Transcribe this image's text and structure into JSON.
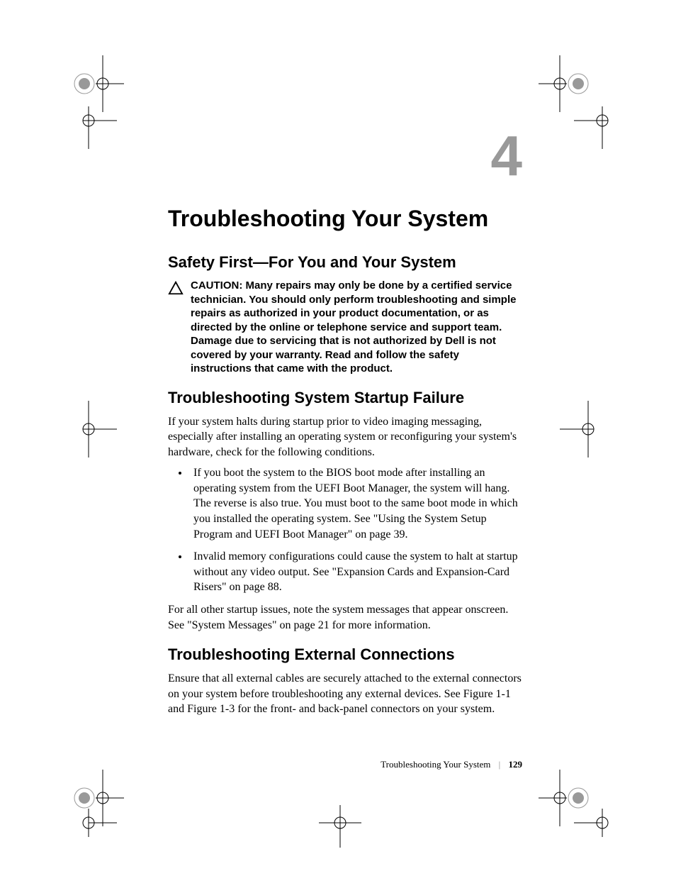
{
  "chapter_number": "4",
  "title": "Troubleshooting Your System",
  "sections": {
    "safety": {
      "heading": "Safety First—For You and Your System",
      "caution_label": "CAUTION: ",
      "caution_body": "Many repairs may only be done by a certified service technician. You should only perform troubleshooting and simple repairs as authorized in your product documentation, or as directed by the online or telephone service and support team. Damage due to servicing that is not authorized by Dell is not covered by your warranty. Read and follow the safety instructions that came with the product."
    },
    "startup": {
      "heading": "Troubleshooting System Startup Failure",
      "intro": "If your system halts during startup prior to video imaging messaging, especially after installing an operating system or reconfiguring your system's hardware, check for the following conditions.",
      "bullets": [
        "If you boot the system to the BIOS boot mode after installing an operating system from the UEFI Boot Manager, the system will hang. The reverse is also true. You must boot to the same boot mode in which you installed the operating system. See \"Using the System Setup Program and UEFI Boot Manager\" on page 39.",
        "Invalid memory configurations could cause the system to halt at startup without any video output. See \"Expansion Cards and Expansion-Card Risers\" on page 88."
      ],
      "outro": "For all other startup issues, note the system messages that appear onscreen. See \"System Messages\" on page 21 for more information."
    },
    "external": {
      "heading": "Troubleshooting External Connections",
      "body": "Ensure that all external cables are securely attached to the external connectors on your system before troubleshooting any external devices. See Figure 1-1 and Figure 1-3 for the front- and back-panel connectors on your system."
    }
  },
  "footer": {
    "title": "Troubleshooting Your System",
    "page": "129"
  }
}
